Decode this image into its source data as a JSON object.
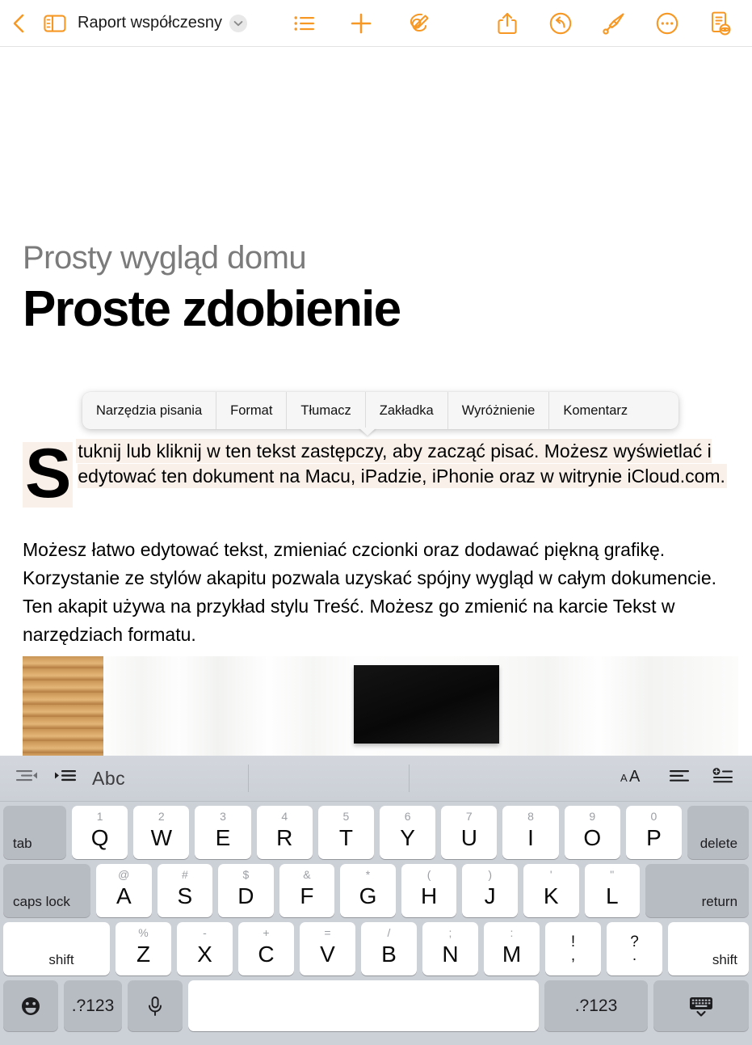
{
  "topbar": {
    "back_icon": "chevron-left-icon",
    "sidebar_icon": "sidebar-toggle-icon",
    "title": "Raport współczesny",
    "title_chevron_icon": "chevron-down-icon",
    "mid_buttons": [
      {
        "name": "format-list-button",
        "icon": "bulleted-list-icon"
      },
      {
        "name": "insert-button",
        "icon": "plus-icon"
      },
      {
        "name": "draw-button",
        "icon": "scribble-pen-icon"
      }
    ],
    "right_buttons": [
      {
        "name": "share-button",
        "icon": "share-up-arrow-icon"
      },
      {
        "name": "undo-button",
        "icon": "undo-arrow-circle-icon"
      },
      {
        "name": "format-paint-button",
        "icon": "paintbrush-icon"
      },
      {
        "name": "more-button",
        "icon": "ellipsis-circle-icon"
      },
      {
        "name": "document-view-button",
        "icon": "document-eye-icon"
      }
    ],
    "accent_color": "#F79824"
  },
  "document": {
    "eyebrow": "Prosty wygląd domu",
    "headline": "Proste zdobienie",
    "dropcap": "S",
    "paragraph_1_rest": "tuknij lub kliknij w ten tekst zastępczy, aby zacząć pisać. Możesz wyświetlać i edytować ten dokument na Macu, iPadzie, iPhonie oraz w witrynie iCloud.com.",
    "paragraph_2": "Możesz łatwo edytować tekst, zmieniać czcionki oraz dodawać piękną grafikę. Korzystanie ze stylów akapitu pozwala uzyskać spójny wygląd w całym dokumencie. Ten akapit używa na przykład stylu Treść. Możesz go zmienić na karcie Tekst w narzędziach formatu.",
    "selection_highlight_color": "#faf0ea",
    "photo_alt": "Wnętrze pokoju z drewnianymi żaluzjami i czarnym obrazem na białej ścianie"
  },
  "context_menu": {
    "items": [
      {
        "label": "Narzędzia pisania",
        "name": "ctx-writing-tools"
      },
      {
        "label": "Format",
        "name": "ctx-format"
      },
      {
        "label": "Tłumacz",
        "name": "ctx-translate"
      },
      {
        "label": "Zakładka",
        "name": "ctx-bookmark"
      },
      {
        "label": "Wyróżnienie",
        "name": "ctx-highlight"
      },
      {
        "label": "Komentarz",
        "name": "ctx-comment"
      }
    ]
  },
  "keyboard_toolbar": {
    "outdent_icon": "outdent-icon",
    "indent_icon": "indent-icon",
    "style_label": "Abc",
    "text_size_icon": "text-size-icon",
    "align_icon": "align-left-icon",
    "insert_list_icon": "insert-list-icon"
  },
  "keyboard": {
    "row1": {
      "tab": "tab",
      "keys": [
        {
          "alt": "1",
          "main": "Q"
        },
        {
          "alt": "2",
          "main": "W"
        },
        {
          "alt": "3",
          "main": "E"
        },
        {
          "alt": "4",
          "main": "R"
        },
        {
          "alt": "5",
          "main": "T"
        },
        {
          "alt": "6",
          "main": "Y"
        },
        {
          "alt": "7",
          "main": "U"
        },
        {
          "alt": "8",
          "main": "I"
        },
        {
          "alt": "9",
          "main": "O"
        },
        {
          "alt": "0",
          "main": "P"
        }
      ],
      "delete": "delete"
    },
    "row2": {
      "caps": "caps lock",
      "keys": [
        {
          "alt": "@",
          "main": "A"
        },
        {
          "alt": "#",
          "main": "S"
        },
        {
          "alt": "$",
          "main": "D"
        },
        {
          "alt": "&",
          "main": "F"
        },
        {
          "alt": "*",
          "main": "G"
        },
        {
          "alt": "(",
          "main": "H"
        },
        {
          "alt": ")",
          "main": "J"
        },
        {
          "alt": "'",
          "main": "K"
        },
        {
          "alt": "\"",
          "main": "L"
        }
      ],
      "return": "return"
    },
    "row3": {
      "shift_left": "shift",
      "keys": [
        {
          "alt": "%",
          "main": "Z"
        },
        {
          "alt": "-",
          "main": "X"
        },
        {
          "alt": "+",
          "main": "C"
        },
        {
          "alt": "=",
          "main": "V"
        },
        {
          "alt": "/",
          "main": "B"
        },
        {
          "alt": ";",
          "main": "N"
        },
        {
          "alt": ":",
          "main": "M"
        }
      ],
      "punct": [
        {
          "up": "!",
          "dn": ","
        },
        {
          "up": "?",
          "dn": "."
        }
      ],
      "shift_right": "shift"
    },
    "row4": {
      "emoji_icon": "emoji-smiley-icon",
      "numbers_left": ".?123",
      "mic_icon": "microphone-icon",
      "space": "",
      "numbers_right": ".?123",
      "dismiss_icon": "dismiss-keyboard-icon"
    }
  }
}
